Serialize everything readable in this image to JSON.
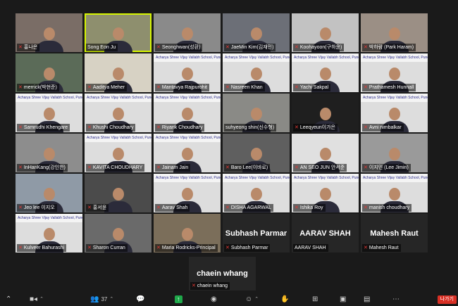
{
  "participants": [
    {
      "name": "홍나은",
      "muted": true,
      "bg": "#7a6d66"
    },
    {
      "name": "Song Eon Ju",
      "muted": false,
      "bg": "#8e8f6e",
      "speaking": true
    },
    {
      "name": "Seonghwan(성환)",
      "muted": true,
      "bg": "#8a8a8a"
    },
    {
      "name": "JaeMin Kim(김재민)",
      "muted": true,
      "bg": "#6c6f77"
    },
    {
      "name": "Koohayoon(구하윤)",
      "muted": true,
      "bg": "#c2c2c2"
    },
    {
      "name": "박하람 (Park Haram)",
      "muted": true,
      "bg": "#9b8f85"
    },
    {
      "name": "merrick(박현준)",
      "muted": true,
      "bg": "#5b6b58"
    },
    {
      "name": "Aaditya Meher",
      "muted": true,
      "bg": "#d7d2c4"
    },
    {
      "name": "Mantavya Rajpurohit",
      "muted": true,
      "bg": "#ddd",
      "banner": "Acharya Shree Vijay Vallabh School, Pune - INDIA"
    },
    {
      "name": "Nasreen Khan",
      "muted": true,
      "bg": "#ddd",
      "banner": "Acharya Shree Vijay Vallabh School, Pune - INDIA"
    },
    {
      "name": "Yachi Sakpal",
      "muted": true,
      "bg": "#ddd",
      "banner": "Acharya Shree Vijay Vallabh School, Pune - INDIA"
    },
    {
      "name": "Prathamesh Hunnall",
      "muted": true,
      "bg": "#ddd",
      "banner": "Acharya Shree Vijay Vallabh School, Pune - INDIA"
    },
    {
      "name": "Samrudhi Khengare",
      "muted": true,
      "bg": "#ddd",
      "banner": "Acharya Shree Vijay Vallabh School, Pune - INDIA"
    },
    {
      "name": "Khushi Choudhary",
      "muted": true,
      "bg": "#ddd",
      "banner": "Acharya Shree Vijay Vallabh School, Pune - INDIA"
    },
    {
      "name": "Riyank Choudhary",
      "muted": true,
      "bg": "#ddd",
      "banner": "Acharya Shree Vijay Vallabh School, Pune - INDIA"
    },
    {
      "name": "suhyeong shin(신수형)",
      "muted": false,
      "bg": "#8a8a86"
    },
    {
      "name": "Leeqyeun이가은",
      "muted": true,
      "bg": "#1f1f1f"
    },
    {
      "name": "Avni nimbalkar",
      "muted": true,
      "bg": "#ddd",
      "banner": "Acharya Shree Vijay Vallabh School, Pune - INDIA"
    },
    {
      "name": "InHanKang(강인한)",
      "muted": true,
      "bg": "#8d8d8d"
    },
    {
      "name": "KAVITA CHOUDHARY",
      "muted": true,
      "bg": "#ddd",
      "banner": "Acharya Shree Vijay Vallabh School, Pune - INDIA"
    },
    {
      "name": "Jainam Jain",
      "muted": true,
      "bg": "#ddd",
      "banner": "Acharya Shree Vijay Vallabh School, Pune - INDIA"
    },
    {
      "name": "Baro Lee(이바로)",
      "muted": true,
      "bg": "#5f5f5f"
    },
    {
      "name": "AN SEO JUN 안서준",
      "muted": true,
      "bg": "#e0e0e0"
    },
    {
      "name": "이지민 (Lee Jimin)",
      "muted": true,
      "bg": "#9a9a9a"
    },
    {
      "name": "Jeo lee 이지오",
      "muted": true,
      "bg": "#8f9aa6"
    },
    {
      "name": "홍서윤",
      "muted": true,
      "bg": "#4b4b4b"
    },
    {
      "name": "Aarav Shah",
      "muted": true,
      "bg": "#ddd",
      "banner": "Acharya Shree Vijay Vallabh School, Pune - INDIA"
    },
    {
      "name": "DISHA AGARWAL",
      "muted": true,
      "bg": "#ddd",
      "banner": "Acharya Shree Vijay Vallabh School, Pune - INDIA"
    },
    {
      "name": "Ishika Roy",
      "muted": true,
      "bg": "#ddd",
      "banner": "Acharya Shree Vijay Vallabh School, Pune - INDIA"
    },
    {
      "name": "manish choudhary",
      "muted": true,
      "bg": "#ddd",
      "banner": "Acharya Shree Vijay Vallabh School, Pune - INDIA"
    },
    {
      "name": "Kulveer Bahurashi",
      "muted": true,
      "bg": "#ddd",
      "banner": "Acharya Shree Vijay Vallabh School, Pune - INDIA"
    },
    {
      "name": "Sharon Curran",
      "muted": true,
      "bg": "#6a6a6a"
    },
    {
      "name": "Maria Rodricks-Principal",
      "muted": true,
      "bg": "#7b6e5a"
    },
    {
      "name": "Subhash Parmar",
      "muted": true,
      "video": false
    },
    {
      "name": "AARAV SHAH",
      "muted": false,
      "video": false
    },
    {
      "name": "Mahesh Raut",
      "muted": true,
      "video": false
    }
  ],
  "lone": {
    "name": "chaein whang",
    "muted": true
  },
  "toolbar": {
    "participants_count": "37",
    "leave_label": "나가기"
  }
}
